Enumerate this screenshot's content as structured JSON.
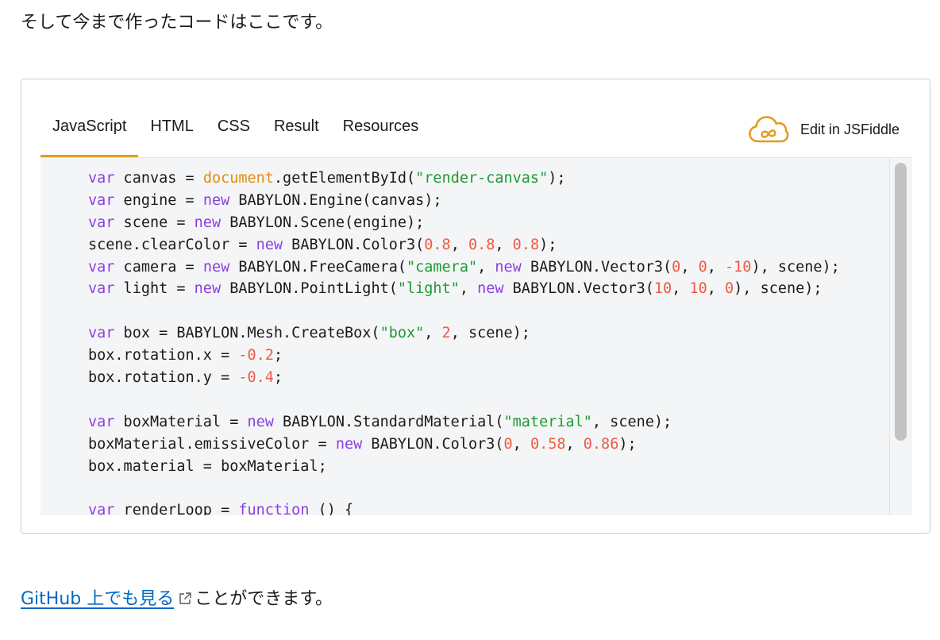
{
  "intro": "そして今まで作ったコードはここです。",
  "embed": {
    "tabs": [
      {
        "label": "JavaScript",
        "active": true
      },
      {
        "label": "HTML",
        "active": false
      },
      {
        "label": "CSS",
        "active": false
      },
      {
        "label": "Result",
        "active": false
      },
      {
        "label": "Resources",
        "active": false
      }
    ],
    "edit_label": "Edit in JSFiddle",
    "edit_icon": "jsfiddle-cloud-icon",
    "accent_color": "#e39b1e",
    "code_lines": [
      [
        [
          "kw",
          "var"
        ],
        [
          "p",
          " canvas = "
        ],
        [
          "glob",
          "document"
        ],
        [
          "p",
          ".getElementById("
        ],
        [
          "str",
          "\"render-canvas\""
        ],
        [
          "p",
          ");"
        ]
      ],
      [
        [
          "kw",
          "var"
        ],
        [
          "p",
          " engine = "
        ],
        [
          "kw",
          "new"
        ],
        [
          "p",
          " BABYLON.Engine(canvas);"
        ]
      ],
      [
        [
          "kw",
          "var"
        ],
        [
          "p",
          " scene = "
        ],
        [
          "kw",
          "new"
        ],
        [
          "p",
          " BABYLON.Scene(engine);"
        ]
      ],
      [
        [
          "p",
          "scene.clearColor = "
        ],
        [
          "kw",
          "new"
        ],
        [
          "p",
          " BABYLON.Color3("
        ],
        [
          "num",
          "0.8"
        ],
        [
          "p",
          ", "
        ],
        [
          "num",
          "0.8"
        ],
        [
          "p",
          ", "
        ],
        [
          "num",
          "0.8"
        ],
        [
          "p",
          ");"
        ]
      ],
      [
        [
          "kw",
          "var"
        ],
        [
          "p",
          " camera = "
        ],
        [
          "kw",
          "new"
        ],
        [
          "p",
          " BABYLON.FreeCamera("
        ],
        [
          "str",
          "\"camera\""
        ],
        [
          "p",
          ", "
        ],
        [
          "kw",
          "new"
        ],
        [
          "p",
          " BABYLON.Vector3("
        ],
        [
          "num",
          "0"
        ],
        [
          "p",
          ", "
        ],
        [
          "num",
          "0"
        ],
        [
          "p",
          ", "
        ],
        [
          "num",
          "-10"
        ],
        [
          "p",
          "), scene);"
        ]
      ],
      [
        [
          "kw",
          "var"
        ],
        [
          "p",
          " light = "
        ],
        [
          "kw",
          "new"
        ],
        [
          "p",
          " BABYLON.PointLight("
        ],
        [
          "str",
          "\"light\""
        ],
        [
          "p",
          ", "
        ],
        [
          "kw",
          "new"
        ],
        [
          "p",
          " BABYLON.Vector3("
        ],
        [
          "num",
          "10"
        ],
        [
          "p",
          ", "
        ],
        [
          "num",
          "10"
        ],
        [
          "p",
          ", "
        ],
        [
          "num",
          "0"
        ],
        [
          "p",
          "), scene);"
        ]
      ],
      [],
      [
        [
          "kw",
          "var"
        ],
        [
          "p",
          " box = BABYLON.Mesh.CreateBox("
        ],
        [
          "str",
          "\"box\""
        ],
        [
          "p",
          ", "
        ],
        [
          "num",
          "2"
        ],
        [
          "p",
          ", scene);"
        ]
      ],
      [
        [
          "p",
          "box.rotation.x = "
        ],
        [
          "num",
          "-0.2"
        ],
        [
          "p",
          ";"
        ]
      ],
      [
        [
          "p",
          "box.rotation.y = "
        ],
        [
          "num",
          "-0.4"
        ],
        [
          "p",
          ";"
        ]
      ],
      [],
      [
        [
          "kw",
          "var"
        ],
        [
          "p",
          " boxMaterial = "
        ],
        [
          "kw",
          "new"
        ],
        [
          "p",
          " BABYLON.StandardMaterial("
        ],
        [
          "str",
          "\"material\""
        ],
        [
          "p",
          ", scene);"
        ]
      ],
      [
        [
          "p",
          "boxMaterial.emissiveColor = "
        ],
        [
          "kw",
          "new"
        ],
        [
          "p",
          " BABYLON.Color3("
        ],
        [
          "num",
          "0"
        ],
        [
          "p",
          ", "
        ],
        [
          "num",
          "0.58"
        ],
        [
          "p",
          ", "
        ],
        [
          "num",
          "0.86"
        ],
        [
          "p",
          ");"
        ]
      ],
      [
        [
          "p",
          "box.material = boxMaterial;"
        ]
      ],
      [],
      [
        [
          "kw",
          "var"
        ],
        [
          "p",
          " renderLoop = "
        ],
        [
          "kw",
          "function"
        ],
        [
          "p",
          " () {"
        ]
      ]
    ]
  },
  "outro": {
    "link_text": "GitHub 上でも見る",
    "link_icon": "external-link-icon",
    "rest": "ことができます。"
  }
}
